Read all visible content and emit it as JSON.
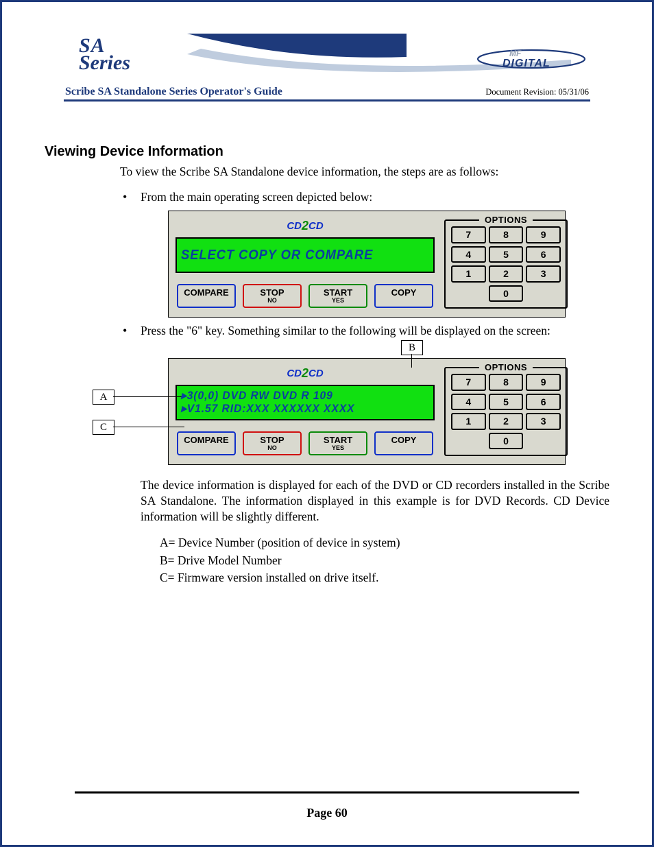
{
  "header": {
    "sa_line1": "SA",
    "sa_line2": "Series",
    "guide_title": "Scribe SA Standalone Series Operator's Guide",
    "revision": "Document Revision: 05/31/06",
    "mfdigital_mf": "MF",
    "mfdigital_digital": "DIGITAL"
  },
  "section": {
    "heading": "Viewing Device Information",
    "intro": "To view the Scribe SA Standalone device information, the steps are as follows:",
    "bullet1": "From the main operating screen depicted below:",
    "bullet2": "Press the \"6\" key. Something similar to the following will be displayed on the screen:",
    "explain": "The device information is displayed for each of the DVD or CD recorders installed in the Scribe SA Standalone.   The information displayed in this example is for DVD Records.  CD Device information will be slightly different.",
    "legend": {
      "a": "A= Device Number (position of device in system)",
      "b": "B= Drive Model Number",
      "c": "C= Firmware version installed on drive itself."
    }
  },
  "panel": {
    "logo_cd": "CD",
    "logo_2": "2",
    "lcd1": "SELECT COPY OR COMPARE",
    "lcd2_line1": "▸3(0,0) DVD RW   DVD R 109",
    "lcd2_line2": "▸V1.57   RID:XXX XXXXXX XXXX",
    "btn_compare": "COMPARE",
    "btn_stop": "STOP",
    "btn_stop_sub": "NO",
    "btn_start": "START",
    "btn_start_sub": "YES",
    "btn_copy": "COPY",
    "keypad_title": "OPTIONS",
    "keys": [
      "7",
      "8",
      "9",
      "4",
      "5",
      "6",
      "1",
      "2",
      "3",
      "0"
    ]
  },
  "callouts": {
    "a": "A",
    "b": "B",
    "c": "C"
  },
  "footer": {
    "page": "Page 60"
  }
}
